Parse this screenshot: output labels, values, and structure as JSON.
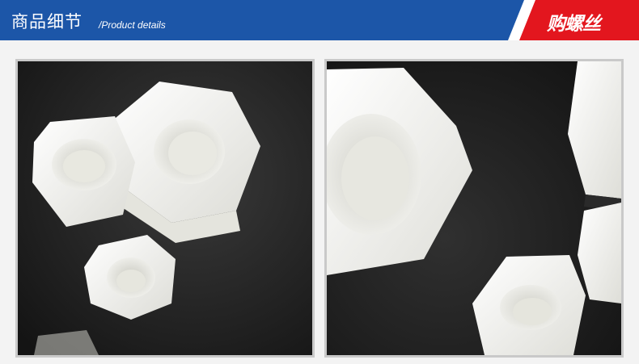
{
  "header": {
    "title": "商品细节",
    "subtitle": "/Product details",
    "brand": "购螺丝"
  },
  "colors": {
    "header_blue": "#1c56a8",
    "brand_red": "#e3161e",
    "background": "#f3f3f3"
  },
  "photos": [
    {
      "name": "photo-left",
      "content": "white nylon hex nuts on black surface"
    },
    {
      "name": "photo-right",
      "content": "close-up of white nylon hex nuts"
    }
  ]
}
